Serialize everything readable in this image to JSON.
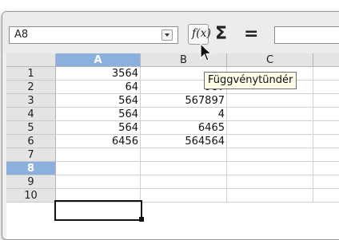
{
  "toolbar": {
    "name_box_value": "A8",
    "function_wizard_icon_label": "f(x)",
    "sum_label": "Σ",
    "equals_label": "=",
    "formula_value": ""
  },
  "tooltip": {
    "text": "Függvénytündér"
  },
  "columns": [
    "A",
    "B",
    "C"
  ],
  "rows": [
    {
      "num": "1",
      "A": "3564",
      "B": "",
      "C": ""
    },
    {
      "num": "2",
      "A": "64",
      "B": "987",
      "C": ""
    },
    {
      "num": "3",
      "A": "564",
      "B": "567897",
      "C": ""
    },
    {
      "num": "4",
      "A": "564",
      "B": "4",
      "C": ""
    },
    {
      "num": "5",
      "A": "564",
      "B": "6465",
      "C": ""
    },
    {
      "num": "6",
      "A": "6456",
      "B": "564564",
      "C": ""
    },
    {
      "num": "7",
      "A": "",
      "B": "",
      "C": ""
    },
    {
      "num": "8",
      "A": "",
      "B": "",
      "C": ""
    },
    {
      "num": "9",
      "A": "",
      "B": "",
      "C": ""
    },
    {
      "num": "10",
      "A": "",
      "B": "",
      "C": ""
    }
  ],
  "active_cell": {
    "column": "A",
    "row": "8"
  },
  "colors": {
    "header_active": "#8cb0de",
    "tooltip_bg": "#fcfce8"
  }
}
